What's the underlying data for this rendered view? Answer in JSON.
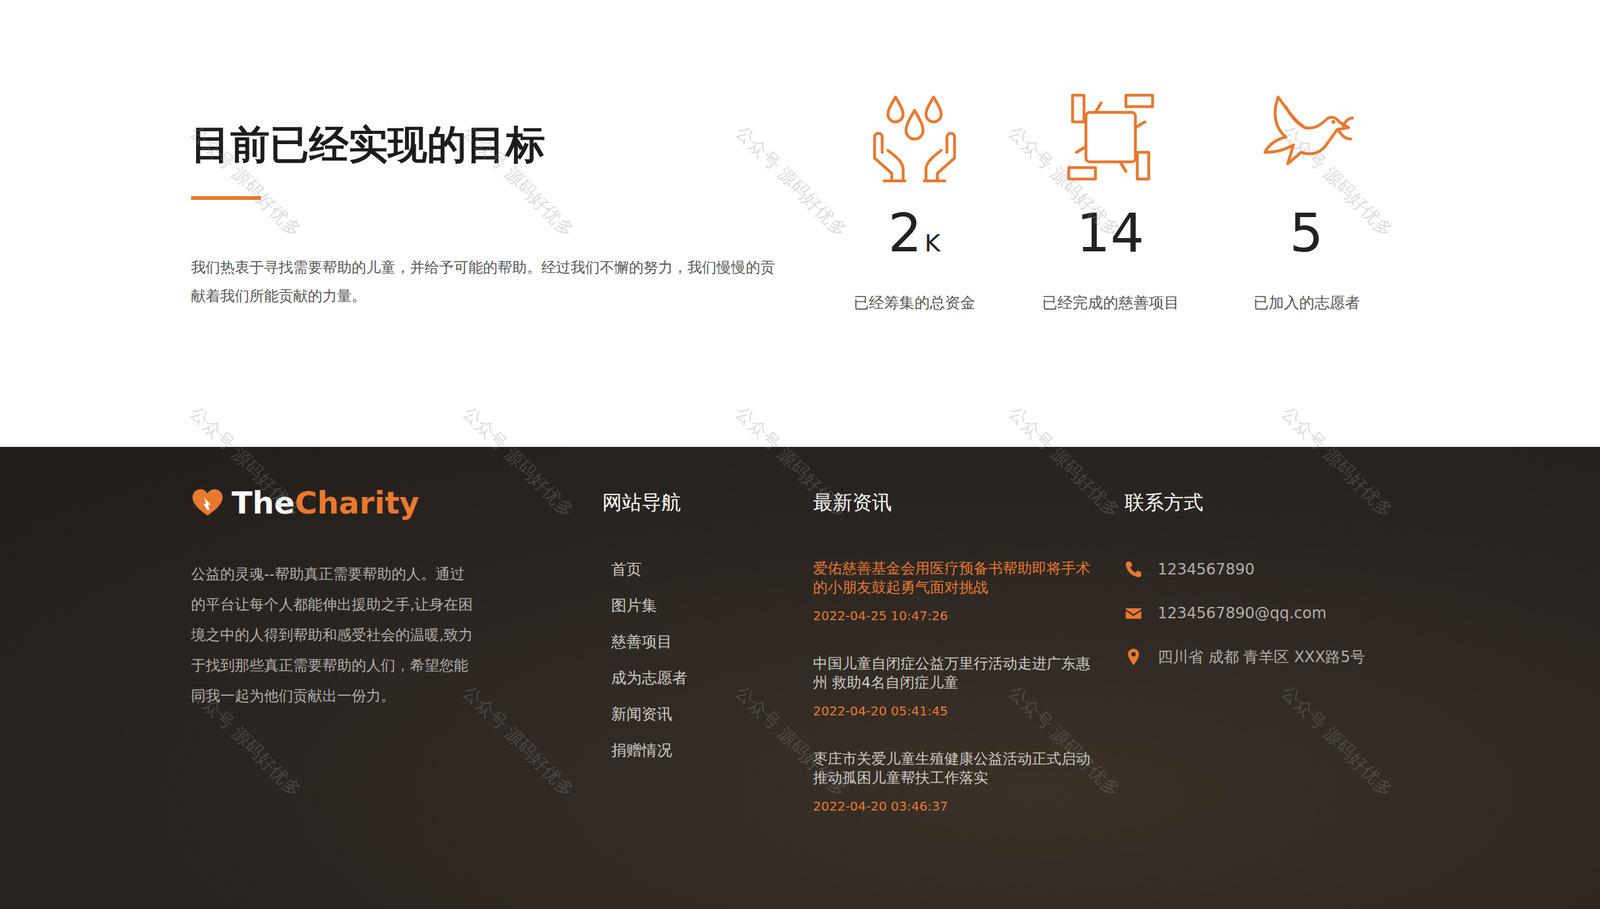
{
  "goals": {
    "title": "目前已经实现的目标",
    "description": "我们热衷于寻找需要帮助的儿童，并给予可能的帮助。经过我们不懈的努力，我们慢慢的贡献着我们所能贡献的力量。",
    "stats": [
      {
        "value": "2",
        "unit": "K",
        "label": "已经筹集的总资金"
      },
      {
        "value": "14",
        "label": "已经完成的慈善项目"
      },
      {
        "value": "5",
        "label": "已加入的志愿者"
      }
    ]
  },
  "footer": {
    "logo": {
      "part1": "The",
      "part2": "Charity"
    },
    "about": "公益的灵魂--帮助真正需要帮助的人。通过的平台让每个人都能伸出援助之手,让身在困境之中的人得到帮助和感受社会的温暖,致力于找到那些真正需要帮助的人们，希望您能同我一起为他们贡献出一份力。",
    "nav": {
      "title": "网站导航",
      "items": [
        "首页",
        "图片集",
        "慈善项目",
        "成为志愿者",
        "新闻资讯",
        "捐赠情况"
      ]
    },
    "news": {
      "title": "最新资讯",
      "items": [
        {
          "title": "爱佑慈善基金会用医疗预备书帮助即将手术的小朋友鼓起勇气面对挑战",
          "date": "2022-04-25 10:47:26",
          "highlighted": true
        },
        {
          "title": "中国儿童自闭症公益万里行活动走进广东惠州 救助4名自闭症儿童",
          "date": "2022-04-20 05:41:45",
          "highlighted": false
        },
        {
          "title": "枣庄市关爱儿童生殖健康公益活动正式启动 推动孤困儿童帮扶工作落实",
          "date": "2022-04-20 03:46:37",
          "highlighted": false
        }
      ]
    },
    "contact": {
      "title": "联系方式",
      "items": [
        "1234567890",
        "1234567890@qq.com",
        "四川省 成都 青羊区 XXX路5号"
      ]
    }
  },
  "watermark": "公众号 源码好优多"
}
